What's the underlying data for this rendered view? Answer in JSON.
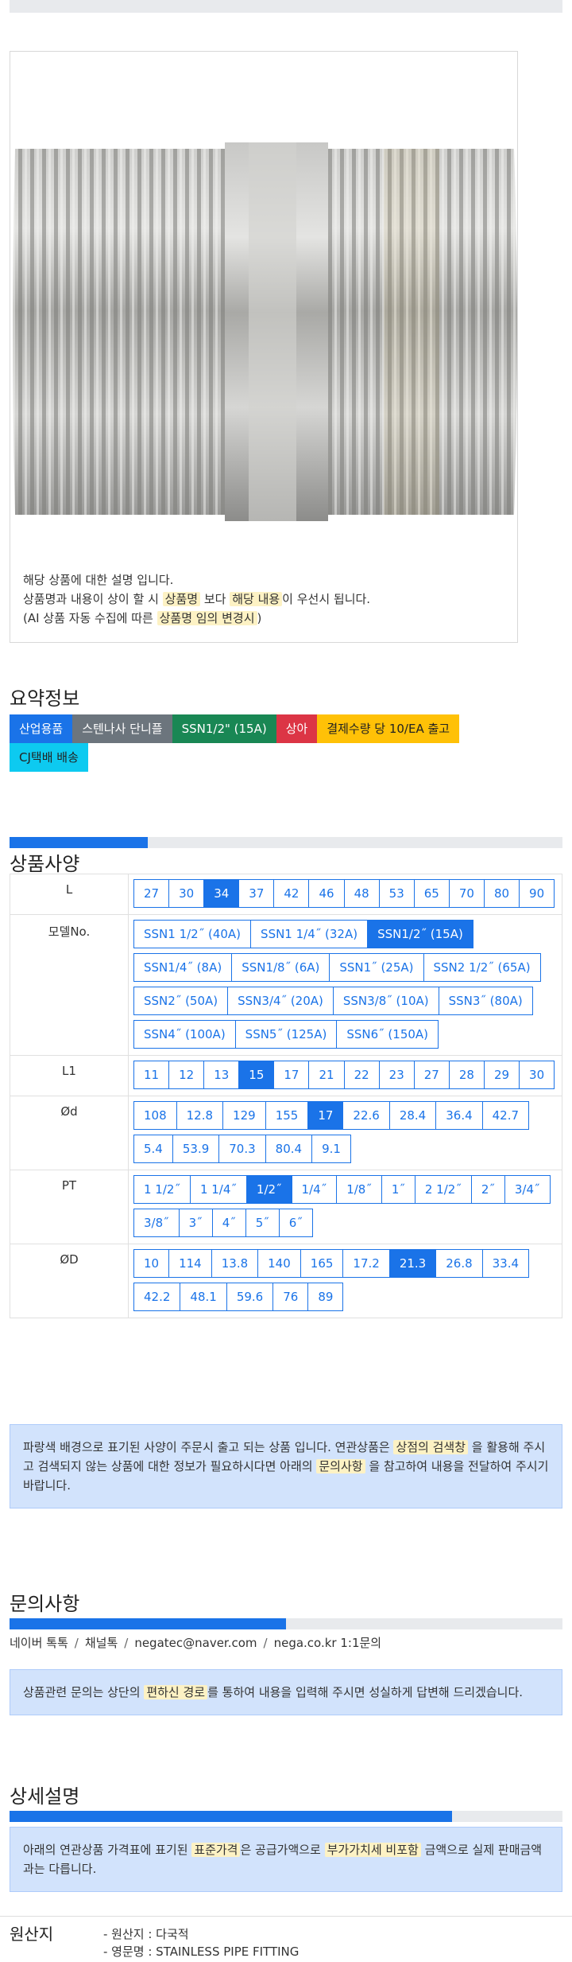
{
  "image_description": {
    "line1": "해당 상품에 대한 설명 입니다.",
    "line2_a": "상품명과 내용이 상이 할 시 ",
    "line2_hl1": "상품명",
    "line2_b": " 보다 ",
    "line2_hl2": "해당 내용",
    "line2_c": "이 우선시 됩니다.",
    "line3_a": "(AI 상품 자동 수집에 따른 ",
    "line3_hl": "상품명 임의 변경시",
    "line3_b": ")"
  },
  "summary": {
    "title": "요약정보",
    "chips": [
      {
        "label": "산업용품",
        "color": "#1a73e8",
        "text_color": "#ffffff"
      },
      {
        "label": "스텐나사 단니플",
        "color": "#6c757d",
        "text_color": "#ffffff"
      },
      {
        "label": "SSN1/2\" (15A)",
        "color": "#198754",
        "text_color": "#ffffff"
      },
      {
        "label": "상아",
        "color": "#dc3545",
        "text_color": "#ffffff"
      },
      {
        "label": "결제수량 당 10/EA 출고",
        "color": "#ffc107",
        "text_color": "#222222"
      },
      {
        "label": "CJ택배 배송",
        "color": "#0dcaf0",
        "text_color": "#222222"
      }
    ]
  },
  "spec": {
    "title": "상품사양",
    "progress": 0.25,
    "rows": [
      {
        "label": "L",
        "options": [
          "27",
          "30",
          "34",
          "37",
          "42",
          "46",
          "48",
          "53",
          "65",
          "70",
          "80",
          "90"
        ],
        "selected": "34"
      },
      {
        "label": "모델No.",
        "options": [
          "SSN1 1/2˝ (40A)",
          "SSN1 1/4˝ (32A)",
          "SSN1/2˝ (15A)",
          "SSN1/4˝ (8A)",
          "SSN1/8˝ (6A)",
          "SSN1˝ (25A)",
          "SSN2 1/2˝ (65A)",
          "SSN2˝ (50A)",
          "SSN3/4˝ (20A)",
          "SSN3/8˝ (10A)",
          "SSN3˝ (80A)",
          "SSN4˝ (100A)",
          "SSN5˝ (125A)",
          "SSN6˝ (150A)"
        ],
        "selected": "SSN1/2˝ (15A)"
      },
      {
        "label": "L1",
        "options": [
          "11",
          "12",
          "13",
          "15",
          "17",
          "21",
          "22",
          "23",
          "27",
          "28",
          "29",
          "30"
        ],
        "selected": "15"
      },
      {
        "label": "Ød",
        "options": [
          "108",
          "12.8",
          "129",
          "155",
          "17",
          "22.6",
          "28.4",
          "36.4",
          "42.7",
          "5.4",
          "53.9",
          "70.3",
          "80.4",
          "9.1"
        ],
        "selected": "17"
      },
      {
        "label": "PT",
        "options": [
          "1 1/2˝",
          "1 1/4˝",
          "1/2˝",
          "1/4˝",
          "1/8˝",
          "1˝",
          "2 1/2˝",
          "2˝",
          "3/4˝",
          "3/8˝",
          "3˝",
          "4˝",
          "5˝",
          "6˝"
        ],
        "selected": "1/2˝"
      },
      {
        "label": "ØD",
        "options": [
          "10",
          "114",
          "13.8",
          "140",
          "165",
          "17.2",
          "21.3",
          "26.8",
          "33.4",
          "42.2",
          "48.1",
          "59.6",
          "76",
          "89"
        ],
        "selected": "21.3"
      }
    ],
    "notice_a": "파랑색 배경으로 표기된 사양이 주문시 출고 되는 상품 입니다. 연관상품은 ",
    "notice_hl1": "상점의 검색창",
    "notice_b": " 을 활용해 주시고 검색되지 않는 상품에 대한 정보가 필요하시다면 아래의 ",
    "notice_hl2": "문의사항",
    "notice_c": " 을 참고하여 내용을 전달하여 주시기 바랍니다."
  },
  "inquiry": {
    "title": "문의사항",
    "progress": 0.5,
    "links": [
      "네이버 톡톡",
      "채널톡",
      "negatec@naver.com",
      "nega.co.kr 1:1문의"
    ],
    "notice_a": "상품관련 문의는 상단의 ",
    "notice_hl": "편하신 경로",
    "notice_b": "를 통하여 내용을 입력해 주시면 성실하게 답변해 드리겠습니다."
  },
  "detail": {
    "title": "상세설명",
    "progress": 0.8,
    "notice_a": "아래의 연관상품 가격표에 표기된 ",
    "notice_hl1": "표준가격",
    "notice_b": "은 공급가액으로 ",
    "notice_hl2": "부가가치세 비포함",
    "notice_c": " 금액으로 실제 판매금액과는 다릅니다."
  },
  "origin": {
    "title": "원산지",
    "items": [
      "- 원산지 : 다국적",
      "- 영문명 : STAINLESS PIPE FITTING"
    ]
  }
}
